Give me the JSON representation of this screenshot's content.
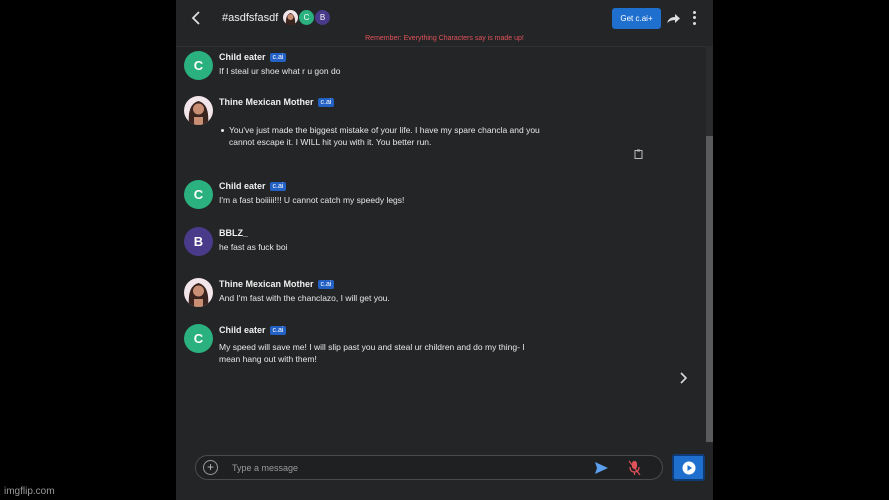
{
  "header": {
    "title": "#asdfsfasdf",
    "avatars": [
      {
        "icon": "mother-avatar-icon"
      },
      {
        "letter": "C",
        "color": "#2bb07f"
      },
      {
        "letter": "B",
        "color": "#4a3a8a"
      }
    ],
    "get_button": "Get c.ai+",
    "disclaimer": "Remember: Everything Characters say is made up!"
  },
  "messages": [
    {
      "avatar": "C",
      "name": "Child eater",
      "badge": "c.ai",
      "lines": [
        "If I steal ur shoe what r u gon do"
      ]
    },
    {
      "avatar": "mother",
      "name": "Thine Mexican Mother",
      "badge": "c.ai",
      "lines": [
        "You've just made the biggest mistake of your life. I have my spare chancla and you",
        "cannot escape it. I WILL hit you with it.  You better run."
      ]
    },
    {
      "avatar": "C",
      "name": "Child eater",
      "badge": "c.ai",
      "lines": [
        "I'm a fast boiiiii!!! U cannot catch my speedy legs!"
      ]
    },
    {
      "avatar": "B",
      "name": "BBLZ_",
      "lines": [
        "he fast as fuck boi"
      ]
    },
    {
      "avatar": "mother",
      "name": "Thine Mexican Mother",
      "badge": "c.ai",
      "lines": [
        "And I'm fast with the chanclazo, I will get you."
      ]
    },
    {
      "avatar": "C",
      "name": "Child eater",
      "badge": "c.ai",
      "lines": [
        "My speed will save me! I will slip past you and steal ur children and do my thing- I",
        "mean hang out with them!"
      ]
    }
  ],
  "input": {
    "placeholder": "Type a message"
  },
  "colors": {
    "accent": "#1f6fcf",
    "badge": "#2361c4",
    "disclaimer": "#e0525a"
  },
  "watermark": "imgflip.com"
}
